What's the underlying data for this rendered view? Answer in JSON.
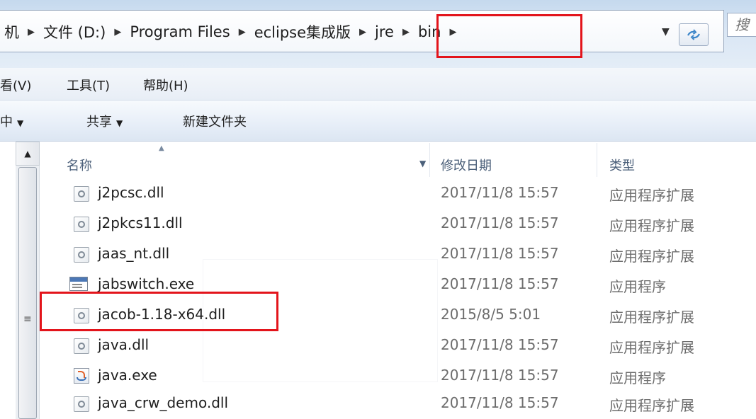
{
  "address_bar": {
    "crumbs": [
      "机",
      "文件 (D:)",
      "Program Files",
      "eclipse集成版",
      "jre",
      "bin"
    ],
    "dropdown_glyph": "▼",
    "search_placeholder": "搜"
  },
  "menubar": {
    "items": [
      "看(V)",
      "工具(T)",
      "帮助(H)"
    ]
  },
  "toolbar": {
    "items": [
      "中",
      "共享",
      "新建文件夹"
    ],
    "arrow": "▼"
  },
  "file_list": {
    "columns": [
      "名称",
      "修改日期",
      "类型"
    ],
    "rows": [
      {
        "name": "j2pcsc.dll",
        "date": "2017/11/8 15:57",
        "type": "应用程序扩展",
        "icon": "dll-icon"
      },
      {
        "name": "j2pkcs11.dll",
        "date": "2017/11/8 15:57",
        "type": "应用程序扩展",
        "icon": "dll-icon"
      },
      {
        "name": "jaas_nt.dll",
        "date": "2017/11/8 15:57",
        "type": "应用程序扩展",
        "icon": "dll-icon"
      },
      {
        "name": "jabswitch.exe",
        "date": "2017/11/8 15:57",
        "type": "应用程序",
        "icon": "exe-icon"
      },
      {
        "name": "jacob-1.18-x64.dll",
        "date": "2015/8/5 5:01",
        "type": "应用程序扩展",
        "icon": "dll-icon"
      },
      {
        "name": "java.dll",
        "date": "2017/11/8 15:57",
        "type": "应用程序扩展",
        "icon": "dll-icon"
      },
      {
        "name": "java.exe",
        "date": "2017/11/8 15:57",
        "type": "应用程序",
        "icon": "java-icon"
      },
      {
        "name": "java_crw_demo.dll",
        "date": "2017/11/8 15:57",
        "type": "应用程序扩展",
        "icon": "dll-icon"
      }
    ]
  },
  "colors": {
    "highlight": "#e3141b",
    "header_text": "#4c607a"
  }
}
